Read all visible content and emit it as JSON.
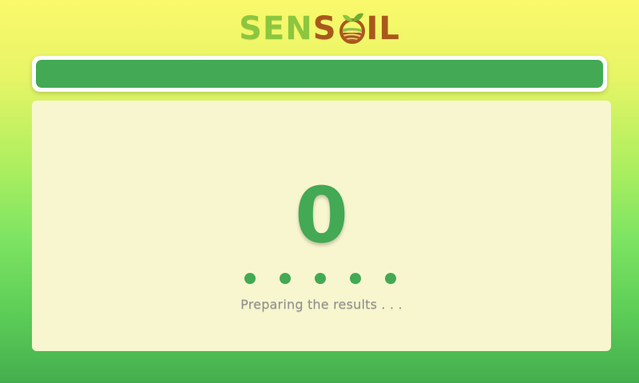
{
  "brand": {
    "part1": "SEN",
    "part2": "S",
    "part3": "IL",
    "logo_icon": "leaf-field-icon",
    "colors": {
      "green": "#8cc63f",
      "brown": "#a9581c"
    }
  },
  "progress": {
    "value": 1.0,
    "color": "#43a954"
  },
  "main": {
    "count": "0",
    "dots": 5,
    "status_text": "Preparing the results . . .",
    "accent": "#43a954",
    "panel_bg": "#f8f6cf"
  }
}
